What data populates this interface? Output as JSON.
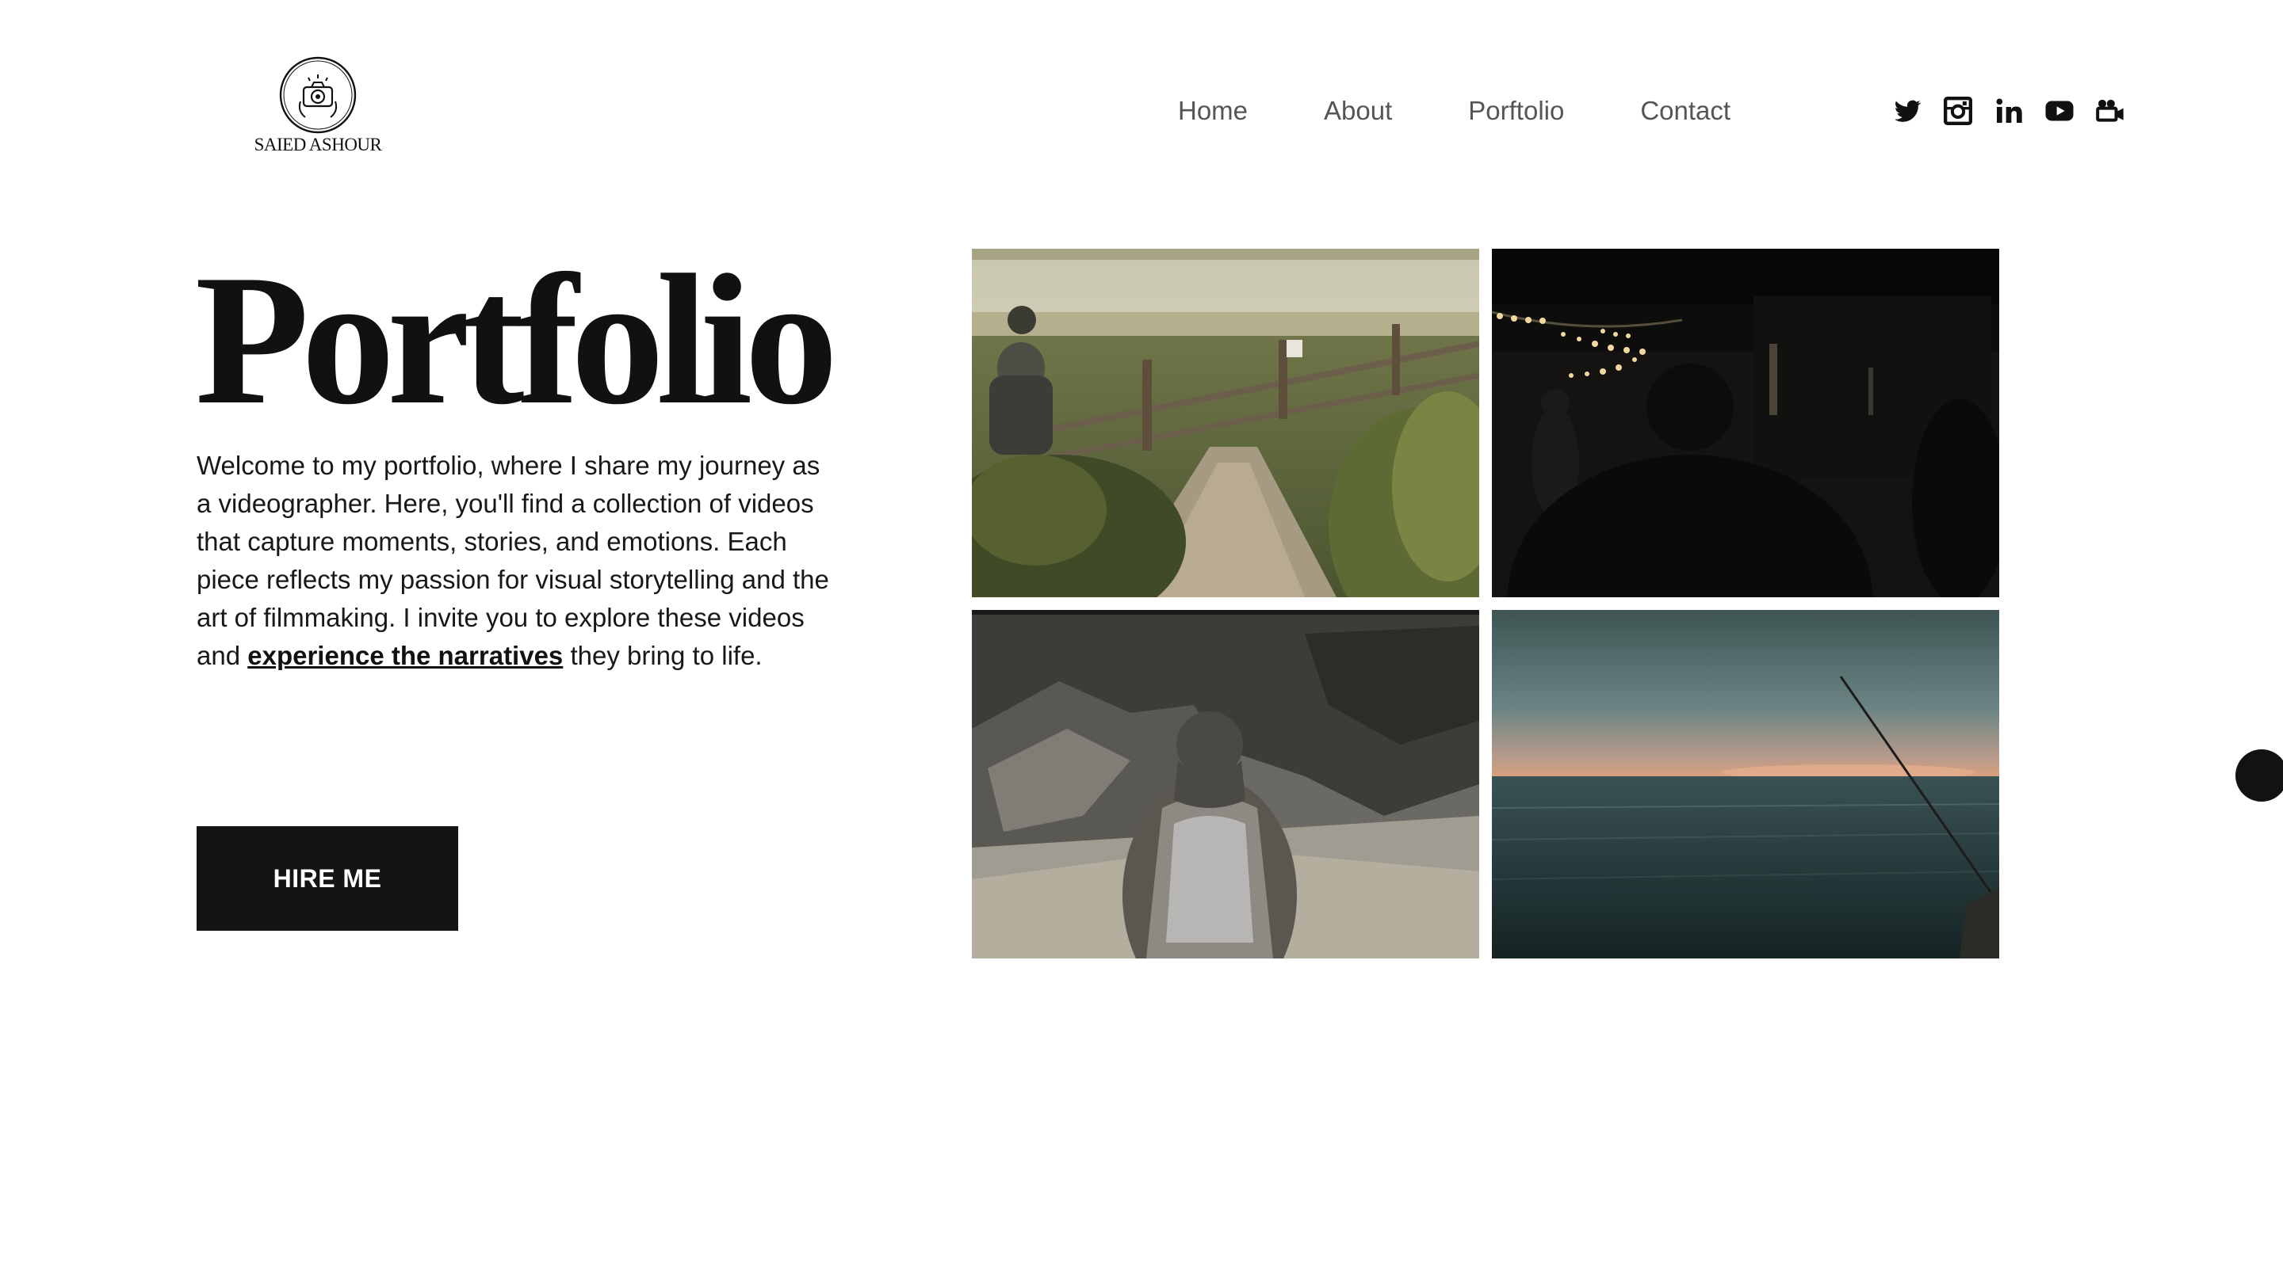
{
  "brand": {
    "name": "SAIED ASHOUR",
    "logo_icon": "camera-in-circle"
  },
  "nav": {
    "items": [
      {
        "label": "Home"
      },
      {
        "label": "About"
      },
      {
        "label": "Porftolio"
      },
      {
        "label": "Contact"
      }
    ]
  },
  "social": {
    "icons": [
      "twitter-icon",
      "instagram-icon",
      "linkedin-icon",
      "youtube-icon",
      "video-camera-icon"
    ]
  },
  "hero": {
    "title": "Portfolio",
    "intro_before_link": "Welcome to my portfolio, where I share my journey as a videographer. Here, you'll find a collection of videos that capture moments, stories, and emotions. Each piece reflects my passion for visual storytelling and the art of filmmaking. I invite you to explore these videos and ",
    "intro_link": "experience the narratives",
    "intro_after_link": " they bring to life.",
    "cta_label": "HIRE ME"
  },
  "gallery": {
    "tiles": [
      {
        "subject": "man at coastal trail fence"
      },
      {
        "subject": "man under string lights at night"
      },
      {
        "subject": "hooded figure on sandy rocks"
      },
      {
        "subject": "fishing rod over ocean at sunset"
      }
    ]
  },
  "colors": {
    "text": "#141414",
    "nav_text": "#555555",
    "button_bg": "#141416",
    "button_text": "#ffffff",
    "background": "#ffffff"
  }
}
